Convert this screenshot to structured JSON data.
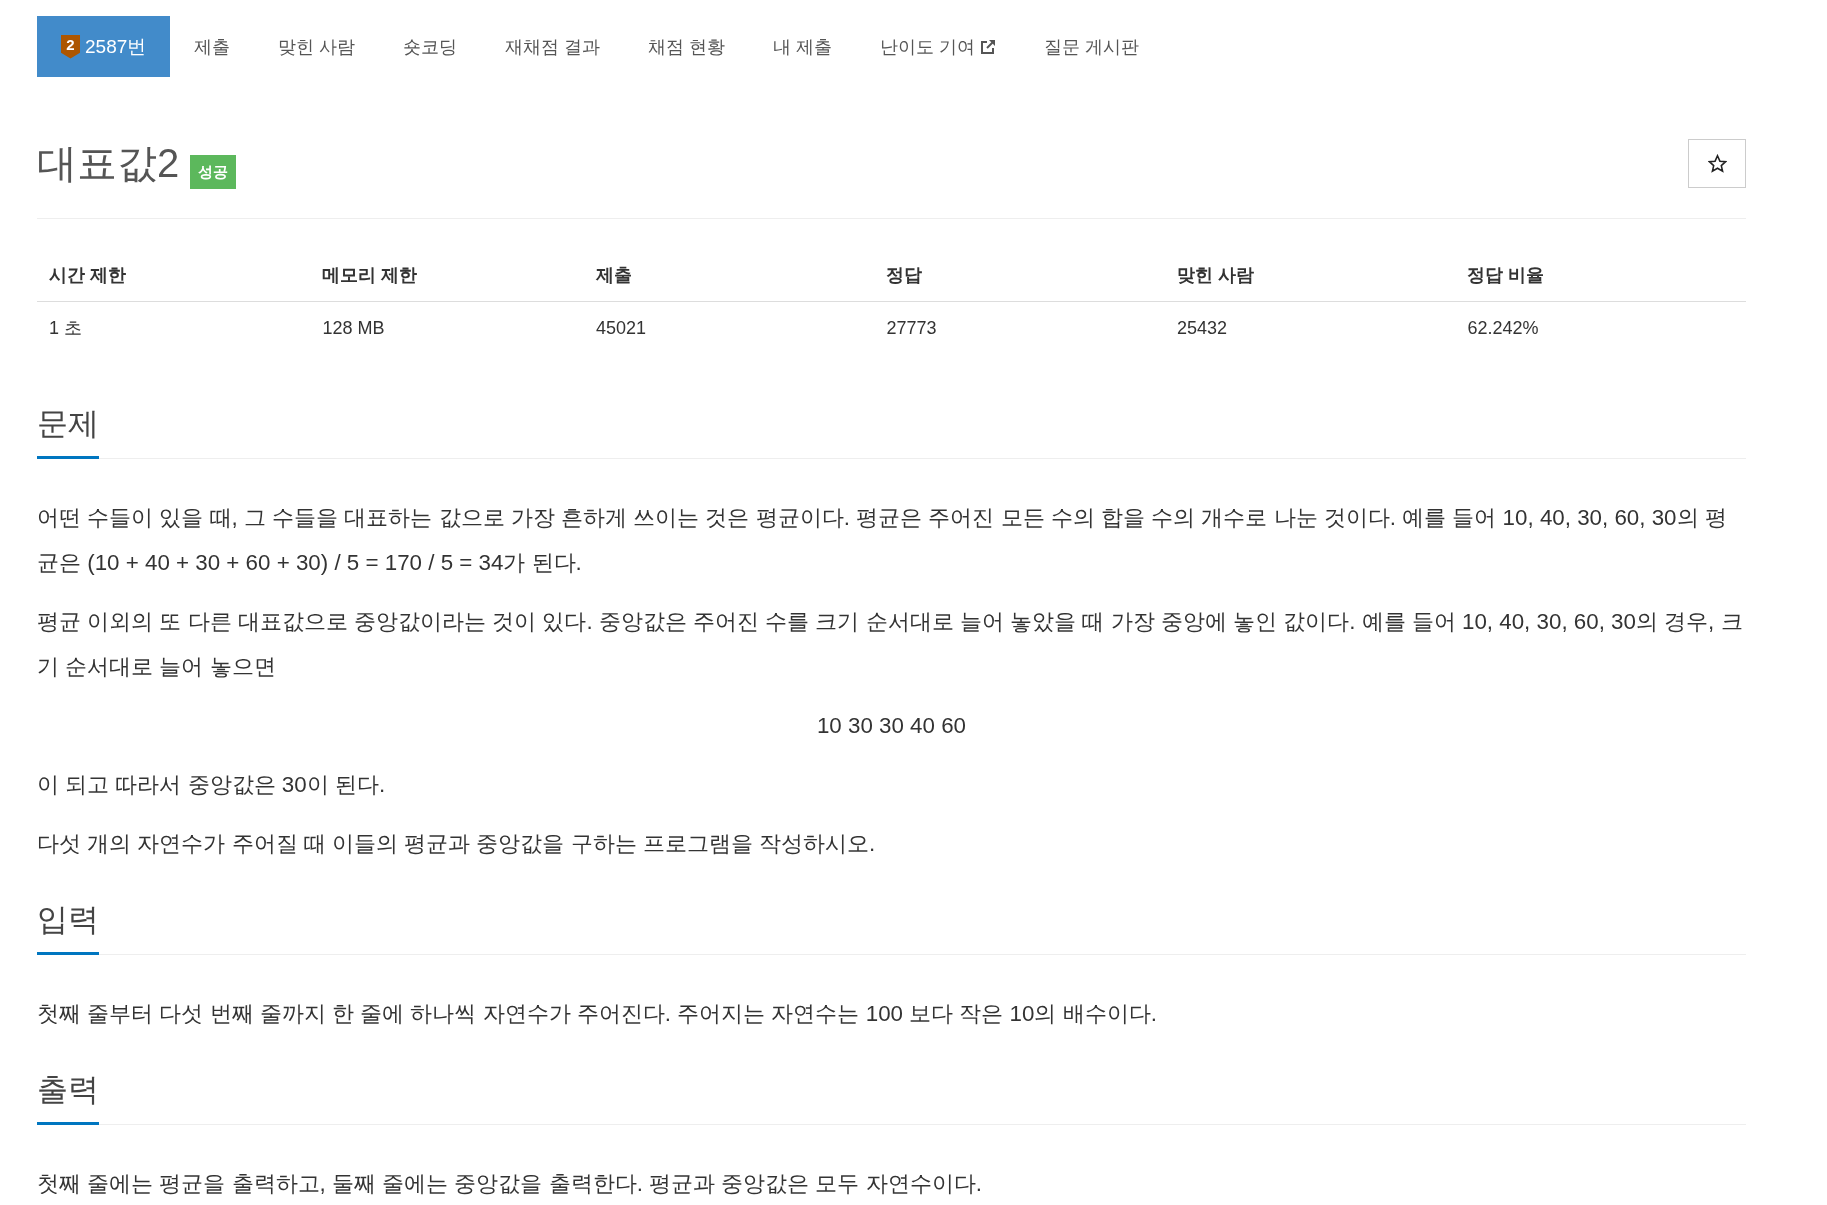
{
  "nav": {
    "tabs": [
      {
        "label": "2587번",
        "selected": true,
        "external": false,
        "tier": "2"
      },
      {
        "label": "제출",
        "selected": false,
        "external": false
      },
      {
        "label": "맞힌 사람",
        "selected": false,
        "external": false
      },
      {
        "label": "숏코딩",
        "selected": false,
        "external": false
      },
      {
        "label": "재채점 결과",
        "selected": false,
        "external": false
      },
      {
        "label": "채점 현황",
        "selected": false,
        "external": false
      },
      {
        "label": "내 제출",
        "selected": false,
        "external": false
      },
      {
        "label": "난이도 기여",
        "selected": false,
        "external": true
      },
      {
        "label": "질문 게시판",
        "selected": false,
        "external": false
      }
    ]
  },
  "problem": {
    "title": "대표값2",
    "status": {
      "label": "성공",
      "kind": "success"
    },
    "starred": false
  },
  "limits": {
    "columns": [
      "시간 제한",
      "메모리 제한",
      "제출",
      "정답",
      "맞힌 사람",
      "정답 비율"
    ],
    "rows": [
      [
        "1 초",
        "128 MB",
        "45021",
        "27773",
        "25432",
        "62.242%"
      ]
    ]
  },
  "sections": [
    {
      "title": "문제",
      "paragraphs": [
        {
          "kind": "text",
          "text": "어떤 수들이 있을 때, 그 수들을 대표하는 값으로 가장 흔하게 쓰이는 것은 평균이다. 평균은 주어진 모든 수의 합을 수의 개수로 나눈 것이다. 예를 들어 10, 40, 30, 60, 30의 평균은 (10 + 40 + 30 + 60 + 30) / 5 = 170 / 5 = 34가 된다."
        },
        {
          "kind": "text",
          "text": "평균 이외의 또 다른 대표값으로 중앙값이라는 것이 있다. 중앙값은 주어진 수를 크기 순서대로 늘어 놓았을 때 가장 중앙에 놓인 값이다. 예를 들어 10, 40, 30, 60, 30의 경우, 크기 순서대로 늘어 놓으면"
        },
        {
          "kind": "centered",
          "text": "10 30 30 40 60"
        },
        {
          "kind": "text",
          "text": "이 되고 따라서 중앙값은 30이 된다."
        },
        {
          "kind": "text",
          "text": "다섯 개의 자연수가 주어질 때 이들의 평균과 중앙값을 구하는 프로그램을 작성하시오."
        }
      ]
    },
    {
      "title": "입력",
      "paragraphs": [
        {
          "kind": "text",
          "text": "첫째 줄부터 다섯 번째 줄까지 한 줄에 하나씩 자연수가 주어진다. 주어지는 자연수는 100 보다 작은 10의 배수이다."
        }
      ]
    },
    {
      "title": "출력",
      "paragraphs": [
        {
          "kind": "text",
          "text": "첫째 줄에는 평균을 출력하고, 둘째 줄에는 중앙값을 출력한다. 평균과 중앙값은 모두 자연수이다."
        }
      ]
    }
  ]
}
